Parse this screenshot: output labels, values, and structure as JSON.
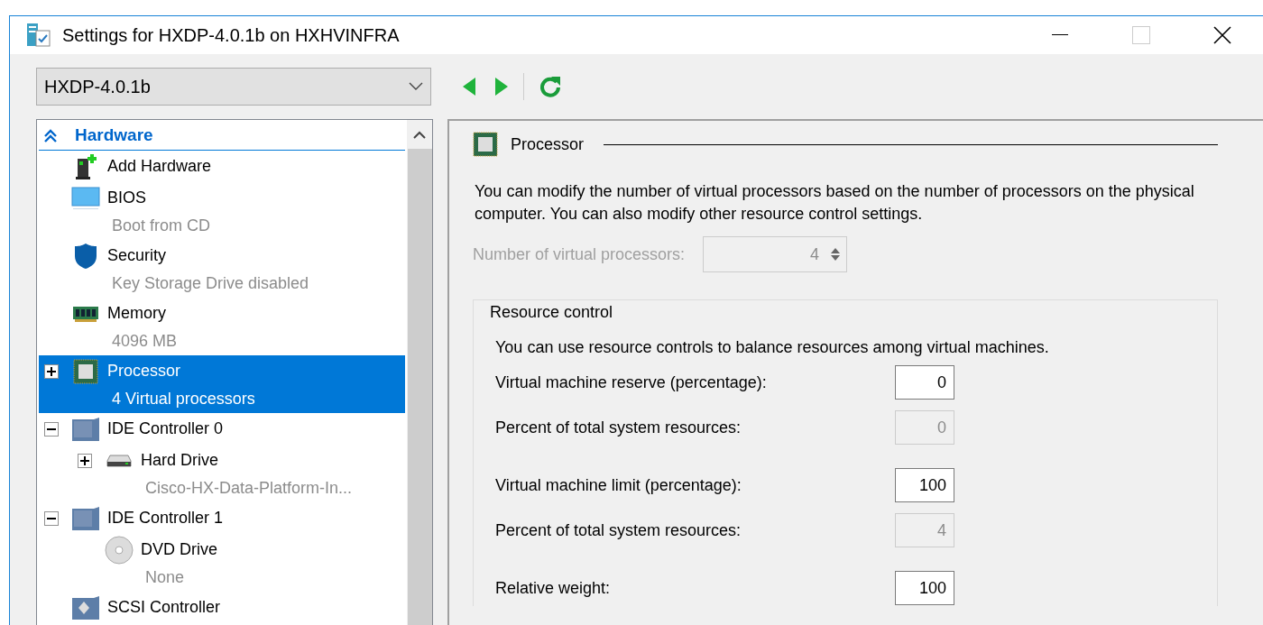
{
  "window": {
    "title": "Settings for HXDP-4.0.1b on HXHVINFRA"
  },
  "toolbar": {
    "vm_select": "HXDP-4.0.1b"
  },
  "sidebar": {
    "section": {
      "label": "Hardware",
      "expanded": true
    },
    "items": [
      {
        "label": "Add Hardware",
        "kind": "server",
        "selected": false
      },
      {
        "label": "BIOS",
        "detail": "Boot from CD",
        "kind": "monitor",
        "selected": false
      },
      {
        "label": "Security",
        "detail": "Key Storage Drive disabled",
        "kind": "shield",
        "selected": false
      },
      {
        "label": "Memory",
        "detail": "4096 MB",
        "kind": "ram",
        "selected": false
      },
      {
        "label": "Processor",
        "detail": "4 Virtual processors",
        "kind": "chip",
        "selected": true,
        "expanded": false
      },
      {
        "label": "IDE Controller 0",
        "kind": "controller",
        "selected": false,
        "expanded": true,
        "children": [
          {
            "label": "Hard Drive",
            "detail": "Cisco-HX-Data-Platform-In...",
            "kind": "drive",
            "selected": false,
            "expanded": false
          }
        ]
      },
      {
        "label": "IDE Controller 1",
        "kind": "controller",
        "selected": false,
        "expanded": true,
        "children": [
          {
            "label": "DVD Drive",
            "detail": "None",
            "kind": "disc",
            "selected": false
          }
        ]
      },
      {
        "label": "SCSI Controller",
        "kind": "scsi",
        "selected": false
      }
    ]
  },
  "panel": {
    "heading": "Processor",
    "description": "You can modify the number of virtual processors based on the number of processors on the physical computer. You can also modify other resource control settings.",
    "processor_count": {
      "label": "Number of virtual processors:",
      "value": "4",
      "disabled": true
    },
    "resource_control": {
      "title": "Resource control",
      "description": "You can use resource controls to balance resources among virtual machines.",
      "fields": [
        {
          "label": "Virtual machine reserve (percentage):",
          "value": "0",
          "disabled": false
        },
        {
          "label": "Percent of total system resources:",
          "value": "0",
          "disabled": true
        },
        {
          "label": "Virtual machine limit (percentage):",
          "value": "100",
          "disabled": false
        },
        {
          "label": "Percent of total system resources:",
          "value": "4",
          "disabled": true
        },
        {
          "label": "Relative weight:",
          "value": "100",
          "disabled": false
        }
      ]
    }
  }
}
